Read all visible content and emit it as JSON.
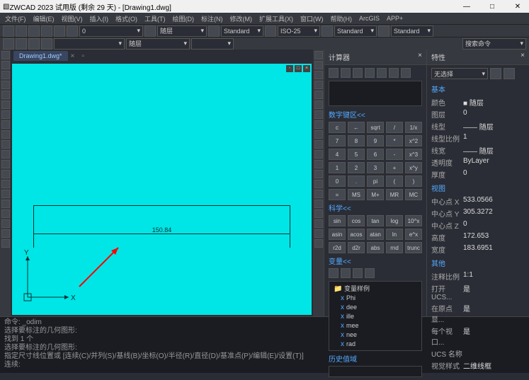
{
  "title": "ZWCAD 2023 试用版 (剩余 29 天) - [Drawing1.dwg]",
  "winbtns": {
    "min": "—",
    "max": "□",
    "close": "✕"
  },
  "menus": [
    "文件(F)",
    "编辑(E)",
    "视图(V)",
    "插入(I)",
    "格式(O)",
    "工具(T)",
    "绘图(D)",
    "标注(N)",
    "修改(M)",
    "扩展工具(X)",
    "窗口(W)",
    "帮助(H)",
    "ArcGIS",
    "APP+"
  ],
  "combos": {
    "layer": "0",
    "linetype": "随层",
    "style1": "Standard",
    "dim": "ISO-25",
    "style2": "Standard",
    "style3": "Standard",
    "search": "搜索命令"
  },
  "tab": "Drawing1.dwg*",
  "dimension": "150.84",
  "axes": {
    "x": "X",
    "y": "Y"
  },
  "calc": {
    "title": "计算器",
    "sections": {
      "keypad": "数字键区<<",
      "sci": "科学<<",
      "vars": "变量<<",
      "hist": "历史值域"
    },
    "keys1": [
      "c",
      "←",
      "sqrt",
      "/",
      "1/x",
      "7",
      "8",
      "9",
      "*",
      "x^2",
      "4",
      "5",
      "6",
      "-",
      "x^3",
      "1",
      "2",
      "3",
      "+",
      "x^y",
      "0",
      ".",
      "pi",
      "(",
      ")",
      "=",
      "MS",
      "M+",
      "MR",
      "MC"
    ],
    "keys2": [
      "sin",
      "cos",
      "tan",
      "log",
      "10^x",
      "asin",
      "acos",
      "atan",
      "ln",
      "e^x",
      "r2d",
      "d2r",
      "abs",
      "rnd",
      "trunc"
    ],
    "vars_hdr": "变量样例",
    "vars": [
      "Phi",
      "dee",
      "ille",
      "mee",
      "nee",
      "rad"
    ]
  },
  "props": {
    "title": "特性",
    "sel": "无选择",
    "sections": {
      "basic": "基本",
      "view": "视图",
      "other": "其他"
    },
    "rows_basic": [
      [
        "颜色",
        "■ 随层"
      ],
      [
        "图层",
        "0"
      ],
      [
        "线型",
        " —— 随层"
      ],
      [
        "线型比例",
        "1"
      ],
      [
        "线宽",
        " —— 随层"
      ],
      [
        "透明度",
        "ByLayer"
      ],
      [
        "厚度",
        "0"
      ]
    ],
    "rows_view": [
      [
        "中心点 X",
        "533.0566"
      ],
      [
        "中心点 Y",
        "305.3272"
      ],
      [
        "中心点 Z",
        "0"
      ],
      [
        "高度",
        "172.653"
      ],
      [
        "宽度",
        "183.6951"
      ]
    ],
    "rows_other": [
      [
        "注释比例",
        "1:1"
      ],
      [
        "打开 UCS...",
        "是"
      ],
      [
        "在原点显...",
        "是"
      ],
      [
        "每个视口...",
        "是"
      ],
      [
        "UCS 名称",
        ""
      ],
      [
        "视觉样式",
        "二维线框"
      ]
    ]
  },
  "cmd": [
    "命令: _odim",
    "选择要标注的几何图形:",
    "找到 1 个",
    "选择要标注的几何图形:",
    "指定尺寸线位置或 [连续(C)/并列(S)/基线(B)/坐标(O)/半径(R)/直径(D)/基准点(P)/编辑(E)/设置(T)]",
    "连续:"
  ]
}
